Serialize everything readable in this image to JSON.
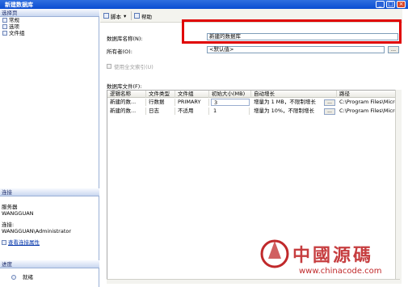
{
  "window": {
    "title": "新建数据库",
    "close_glyph": "×",
    "max_glyph": "□"
  },
  "left_pane": {
    "select_page_header": "选择页",
    "nav_items": [
      {
        "label": "常规",
        "icon": "page-icon"
      },
      {
        "label": "选项",
        "icon": "page-icon"
      },
      {
        "label": "文件组",
        "icon": "page-icon"
      }
    ],
    "connection_header": "连接",
    "server_label": "服务器",
    "server_value": "WANGGUAN",
    "connection_label": "连接:",
    "connection_value": "WANGGUAN\\Administrator",
    "view_props_link": "查看连接属性",
    "progress_header": "进度",
    "progress_status": "就绪"
  },
  "toolbar": {
    "script_label": "脚本",
    "help_label": "帮助"
  },
  "form": {
    "db_name_label": "数据库名称(N):",
    "db_name_value": "新建的数据库",
    "owner_label": "所有者(O):",
    "owner_value": "<默认值>",
    "fulltext_label": "使用全文索引(U)",
    "files_label": "数据库文件(F):",
    "browse_glyph": "..."
  },
  "grid": {
    "columns": [
      "逻辑名称",
      "文件类型",
      "文件组",
      "初始大小(MB)",
      "自动增长",
      "路径"
    ],
    "rows": [
      [
        "新建的数...",
        "行数据",
        "PRIMARY",
        "3",
        "增量为 1 MB，不限制增长",
        "C:\\Program Files\\Micro"
      ],
      [
        "新建的数...",
        "日志",
        "不适用",
        "1",
        "增量为 10%，不限制增长",
        "C:\\Program Files\\Micro"
      ]
    ]
  },
  "watermark": {
    "text": "中國源碼",
    "url": "www.chinacode.com"
  }
}
